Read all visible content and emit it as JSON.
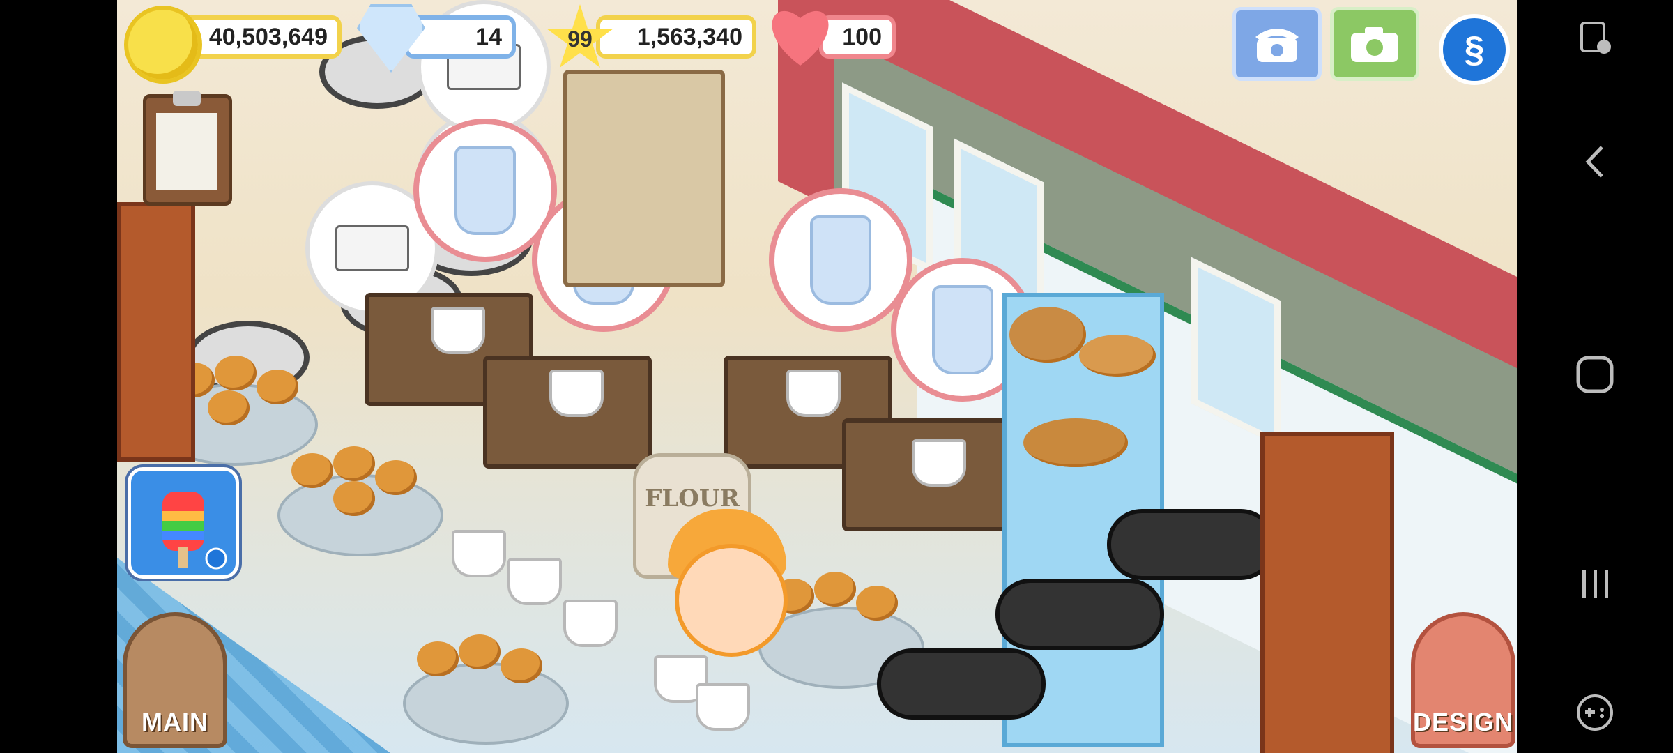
{
  "hud": {
    "coins": "40,503,649",
    "gems": "14",
    "level": "99",
    "xp": "1,563,340",
    "hearts": "100"
  },
  "buttons": {
    "main_label": "MAIN",
    "design_label": "DESIGN"
  },
  "scene": {
    "flour_label": "FLOUR"
  },
  "icons": {
    "coin": "coin-icon",
    "gem": "diamond-icon",
    "star": "star-icon",
    "heart": "heart-icon",
    "phone": "phone-icon",
    "camera": "camera-icon",
    "s_logo": "s-logo-icon",
    "clipboard": "clipboard-icon",
    "screen_lock": "screen-rotate-lock-icon",
    "back": "back-icon",
    "home": "home-icon",
    "recents": "recents-icon",
    "game_tools": "game-controller-icon"
  },
  "colors": {
    "coin_border": "#f2d24b",
    "gem_border": "#7fb2e8",
    "heart_border": "#f0868d",
    "phone_button": "#7ea7e6",
    "camera_button": "#8cc864",
    "main_button": "#b78a62",
    "design_button": "#e38570"
  }
}
